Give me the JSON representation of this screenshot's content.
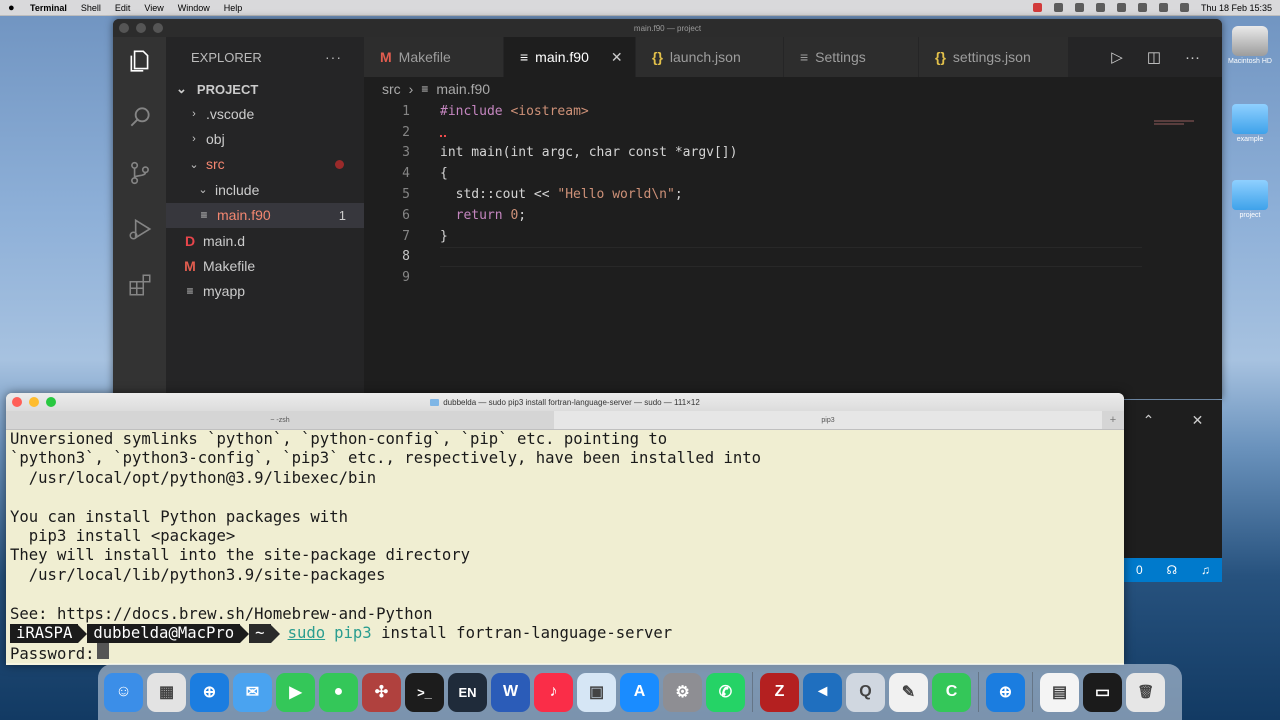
{
  "menubar": {
    "app_name": "Terminal",
    "menus": [
      "Shell",
      "Edit",
      "View",
      "Window",
      "Help"
    ],
    "clock": "Thu 18 Feb  15:35"
  },
  "desktop": {
    "icons": [
      "Macintosh HD",
      "example",
      "project"
    ]
  },
  "vscode": {
    "window_title": "main.f90 — project",
    "explorer_title": "EXPLORER",
    "project_label": "PROJECT",
    "tree": [
      {
        "label": ".vscode",
        "kind": "folder-closed",
        "indent": 1
      },
      {
        "label": "obj",
        "kind": "folder-closed",
        "indent": 1
      },
      {
        "label": "src",
        "kind": "folder-open",
        "indent": 1
      },
      {
        "label": "include",
        "kind": "folder-open",
        "indent": 2
      },
      {
        "label": "main.f90",
        "kind": "file-lines",
        "indent": 2,
        "count": "1"
      },
      {
        "label": "main.d",
        "kind": "file-D",
        "indent": 1
      },
      {
        "label": "Makefile",
        "kind": "file-M",
        "indent": 1
      },
      {
        "label": "myapp",
        "kind": "file-lines",
        "indent": 1
      }
    ],
    "tabs": [
      {
        "label": "Makefile",
        "icon": "M"
      },
      {
        "label": "main.f90",
        "icon": "≡",
        "active": true
      },
      {
        "label": "launch.json",
        "icon": "{}"
      },
      {
        "label": "Settings",
        "icon": "≡"
      },
      {
        "label": "settings.json",
        "icon": "{}"
      }
    ],
    "breadcrumb": {
      "folder": "src",
      "sep": "›",
      "file": "main.f90"
    },
    "code": [
      {
        "n": "1",
        "html_key": "l1"
      },
      {
        "n": "2",
        "html_key": "l2"
      },
      {
        "n": "3",
        "html_key": "l3"
      },
      {
        "n": "4",
        "html_key": "l4"
      },
      {
        "n": "5",
        "html_key": "l5"
      },
      {
        "n": "6",
        "html_key": "l6"
      },
      {
        "n": "7",
        "html_key": "l7"
      },
      {
        "n": "8",
        "html_key": "l8"
      },
      {
        "n": "9",
        "html_key": "l9"
      }
    ],
    "code_text": {
      "l1_a": "#include",
      "l1_b": " <iostream>",
      "l3_a": "int",
      "l3_b": " main(",
      "l3_c": "int",
      "l3_d": " argc, ",
      "l3_e": "char",
      "l3_f": " ",
      "l3_g": "const",
      "l3_h": " *argv[])",
      "l4": "{",
      "l5_a": "  std::cout << ",
      "l5_b": "\"Hello world\\n\"",
      "l5_c": ";",
      "l6_a": "  ",
      "l6_b": "return",
      "l6_c": " ",
      "l6_d": "0",
      "l6_e": ";",
      "l7": "}"
    },
    "status_fragment": "0"
  },
  "terminal": {
    "window_title": "dubbelda — sudo pip3 install fortran-language-server — sudo — 111×12",
    "tabs": [
      "~ -zsh",
      "pip3"
    ],
    "output": [
      "Unversioned symlinks `python`, `python-config`, `pip` etc. pointing to",
      "`python3`, `python3-config`, `pip3` etc., respectively, have been installed into",
      "  /usr/local/opt/python@3.9/libexec/bin",
      "",
      "You can install Python packages with",
      "  pip3 install <package>",
      "They will install into the site-package directory",
      "  /usr/local/lib/python3.9/site-packages",
      "",
      "See: https://docs.brew.sh/Homebrew-and-Python"
    ],
    "prompt": {
      "host": "iRASPA",
      "user": "dubbelda@MacPro",
      "dir": "~",
      "cmd_sudo": "sudo",
      "cmd_pip": "pip3",
      "cmd_rest": " install fortran-language-server"
    },
    "password_label": "Password:"
  },
  "dock": {
    "apps": [
      {
        "name": "finder-icon",
        "color": "#3b8ee8",
        "glyph": "☺"
      },
      {
        "name": "launchpad-icon",
        "color": "#e3e3e3",
        "glyph": "▦"
      },
      {
        "name": "safari-icon",
        "color": "#1b7de0",
        "glyph": "⊕"
      },
      {
        "name": "mail-icon",
        "color": "#4aa3f0",
        "glyph": "✉"
      },
      {
        "name": "facetime-icon",
        "color": "#34c759",
        "glyph": "▶"
      },
      {
        "name": "messages-icon",
        "color": "#34c759",
        "glyph": "●"
      },
      {
        "name": "chess-icon",
        "color": "#b0413e",
        "glyph": "✣"
      },
      {
        "name": "terminal-icon",
        "color": "#1c1c1c",
        "glyph": ">_"
      },
      {
        "name": "dictionary-icon",
        "color": "#1f2b3a",
        "glyph": "EN"
      },
      {
        "name": "word-icon",
        "color": "#2b5cb8",
        "glyph": "W"
      },
      {
        "name": "music-icon",
        "color": "#fa2d48",
        "glyph": "♪"
      },
      {
        "name": "preview-icon",
        "color": "#d6e6f5",
        "glyph": "▣"
      },
      {
        "name": "app-store-icon",
        "color": "#1a8cff",
        "glyph": "A"
      },
      {
        "name": "system-preferences-icon",
        "color": "#8e8e93",
        "glyph": "⚙"
      },
      {
        "name": "whatsapp-icon",
        "color": "#25d366",
        "glyph": "✆"
      },
      {
        "name": "filezilla-icon",
        "color": "#b42020",
        "glyph": "Z"
      },
      {
        "name": "vscode-icon",
        "color": "#1f6fbf",
        "glyph": "◄"
      },
      {
        "name": "quicktime-icon",
        "color": "#d0d7e0",
        "glyph": "Q"
      },
      {
        "name": "textedit-icon",
        "color": "#f1f1f1",
        "glyph": "✎"
      },
      {
        "name": "numbers-icon",
        "color": "#34c759",
        "glyph": "C"
      },
      {
        "name": "safari-download-icon",
        "color": "#1b7de0",
        "glyph": "⊕"
      },
      {
        "name": "archive-icon",
        "color": "#f4f4f4",
        "glyph": "▤"
      },
      {
        "name": "display-icon",
        "color": "#1b1b1b",
        "glyph": "▭"
      },
      {
        "name": "trash-icon",
        "color": "#e6e6e6",
        "glyph": "🗑"
      }
    ]
  }
}
